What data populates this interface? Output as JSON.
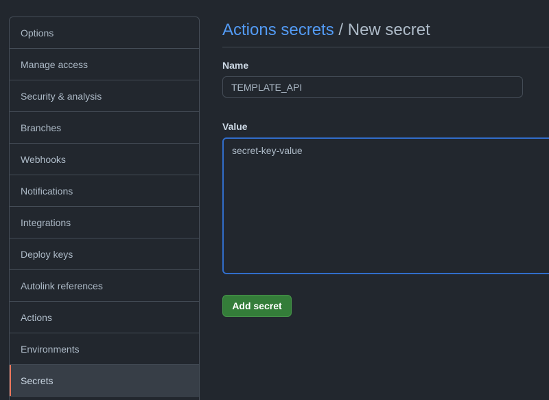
{
  "sidebar": {
    "items": [
      {
        "label": "Options"
      },
      {
        "label": "Manage access"
      },
      {
        "label": "Security & analysis"
      },
      {
        "label": "Branches"
      },
      {
        "label": "Webhooks"
      },
      {
        "label": "Notifications"
      },
      {
        "label": "Integrations"
      },
      {
        "label": "Deploy keys"
      },
      {
        "label": "Autolink references"
      },
      {
        "label": "Actions"
      },
      {
        "label": "Environments"
      },
      {
        "label": "Secrets",
        "selected": true
      }
    ]
  },
  "header": {
    "breadcrumb_link": "Actions secrets",
    "separator": "/",
    "current": "New secret"
  },
  "form": {
    "name_label": "Name",
    "name_value": "TEMPLATE_API",
    "value_label": "Value",
    "value_value": "secret-key-value",
    "submit_label": "Add secret"
  },
  "colors": {
    "background": "#22272e",
    "link": "#539bf5",
    "selected_accent": "#ec775c",
    "button_green": "#347d39",
    "focus_border": "#316dca"
  }
}
